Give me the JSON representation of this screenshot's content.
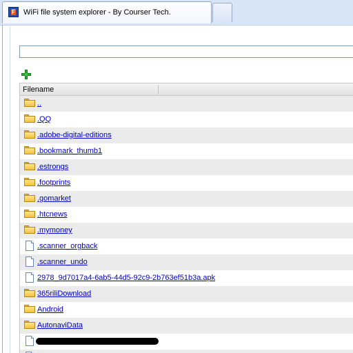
{
  "window": {
    "tab_title": "WiFi file system explorer - By Courser Tech.",
    "tab_icon": "app-logo-icon"
  },
  "path_input": {
    "value": "",
    "placeholder": ""
  },
  "toolbar": {
    "add_icon": "add-plus-icon"
  },
  "table": {
    "columns": [
      "Filename"
    ],
    "rows": [
      {
        "type": "folder",
        "name": ".."
      },
      {
        "type": "folder",
        "name": ".QQ"
      },
      {
        "type": "folder",
        "name": ".adobe-digital-editions"
      },
      {
        "type": "folder",
        "name": ".bookmark_thumb1"
      },
      {
        "type": "folder",
        "name": ".estrongs"
      },
      {
        "type": "folder",
        "name": ".footprints"
      },
      {
        "type": "folder",
        "name": ".gomarket"
      },
      {
        "type": "folder",
        "name": ".htcnews"
      },
      {
        "type": "folder",
        "name": ".mymoney"
      },
      {
        "type": "file",
        "name": ".scanner_orgback"
      },
      {
        "type": "file",
        "name": ".scanner_undo"
      },
      {
        "type": "file",
        "name": "2978_9d7017a4-6ab5-44d5-92c9-2b763ef51b3a.apk"
      },
      {
        "type": "folder",
        "name": "365riliDownload"
      },
      {
        "type": "folder",
        "name": "Android"
      },
      {
        "type": "folder",
        "name": "AutonaviData"
      },
      {
        "type": "file",
        "name": "",
        "redacted": true
      },
      {
        "type": "file",
        "name": "",
        "redacted": true
      }
    ]
  },
  "colors": {
    "link": "#0000cc",
    "alt_row": "#ebebeb",
    "tab_strip": "#d8e4f8",
    "folder": "#f3c33d",
    "add_icon": "#2fa82f"
  }
}
